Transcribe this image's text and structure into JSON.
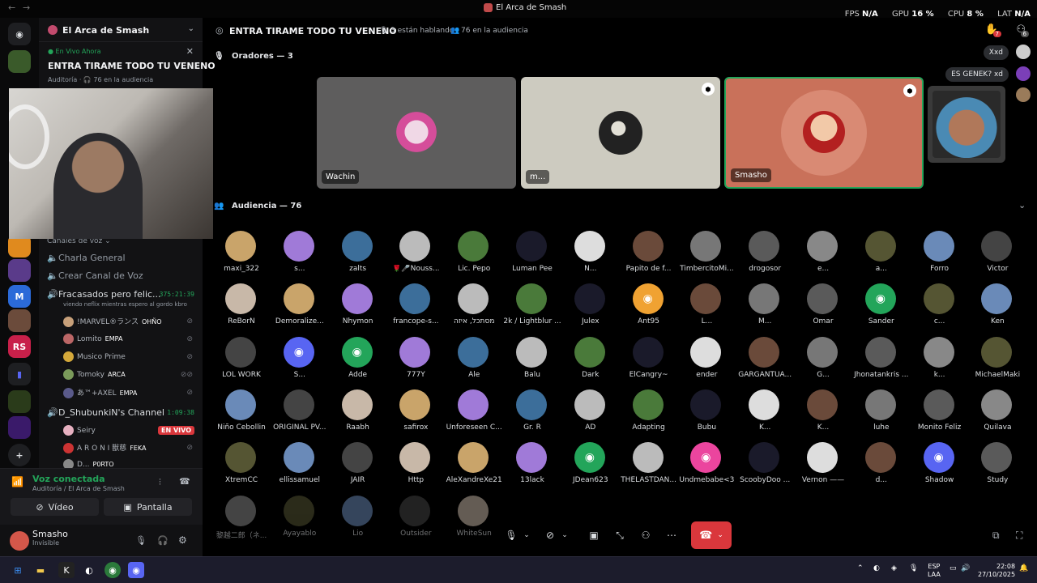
{
  "window": {
    "title": "El Arca de Smash",
    "back": "←",
    "forward": "→"
  },
  "perf": {
    "fps_label": "FPS",
    "fps": "N/A",
    "gpu_label": "GPU",
    "gpu": "16 %",
    "cpu_label": "CPU",
    "cpu": "8 %",
    "lat_label": "LAT",
    "lat": "N/A"
  },
  "guild": {
    "name": "El Arca de Smash"
  },
  "live": {
    "badge": "En Vivo Ahora",
    "stage_title": "ENTRA TIRAME TODO TU VENENO",
    "sub": "Auditoría · 🎧 76 en la audiencia"
  },
  "categories": {
    "voice": "Canales de voz"
  },
  "channels": [
    {
      "name": "Charla General",
      "icon": "speaker-icon"
    },
    {
      "name": "Crear Canal de Voz",
      "icon": "speaker-icon"
    },
    {
      "name": "Fracasados pero felic...",
      "timer": "375:21:39",
      "status": "viendo neflix mientras espero al gordo kbro"
    },
    {
      "name": "D_ShubunkiN's Channel",
      "timer": "1:09:38"
    }
  ],
  "voice_users_a": [
    {
      "name": "!MARVEL®ランス",
      "tag": "OHÑO"
    },
    {
      "name": "Lomito",
      "tag": "EMPA"
    },
    {
      "name": "Musico Prime",
      "tag": ""
    },
    {
      "name": "Tomoky",
      "tag": "ARCA"
    },
    {
      "name": "あ™+AXEL",
      "tag": "EMPA"
    }
  ],
  "voice_users_b": [
    {
      "name": "Seiry",
      "tag": "EN VIVO"
    },
    {
      "name": "A R O N I 獣慈",
      "tag": "FEKA"
    },
    {
      "name": "D...",
      "tag": "P0RTO"
    }
  ],
  "voice_panel": {
    "status": "Voz conectada",
    "location": "Auditoría / El Arca de Smash",
    "video": "Vídeo",
    "screen": "Pantalla"
  },
  "user": {
    "name": "Smasho",
    "status": "Invisible"
  },
  "stage": {
    "title": "ENTRA TIRAME TODO TU VENENO",
    "speaking": "3 están hablando",
    "audience": "76 en la audiencia",
    "speakers_header": "Oradores — 3",
    "audience_header": "Audiencia — 76",
    "notif_count": "7",
    "notif_count2": "6"
  },
  "speakers": [
    {
      "name": "Wachin"
    },
    {
      "name": "m..."
    },
    {
      "name": "Smasho"
    }
  ],
  "chat": [
    {
      "text": "Xxd"
    },
    {
      "text": "ES GENEK? xd"
    }
  ],
  "audience": [
    "maxi_322",
    "s...",
    "zalts",
    "🌹🎤Nouss...",
    "Lic. Pepo",
    "Luman Pee",
    "N...",
    "Papito de f...",
    "TimbercitoMi...",
    "drogosor",
    "e...",
    "a...",
    "Forro",
    "Victor",
    "ReBorN",
    "Demoralize...",
    "Nhymon",
    "francope-s...",
    "מסתכל, איזה",
    "2k / Lightblur ...",
    "Julex",
    "Ant95",
    "L...",
    "M...",
    "Omar",
    "Sander",
    "c...",
    "Ken",
    "LOL WORK",
    "S...",
    "Adde",
    "777Y",
    "Ale",
    "Balu",
    "Dark",
    "ElCangry~",
    "ender",
    "GARGANTUA...",
    "G...",
    "Jhonatankris ...",
    "k...",
    "MichaelMaki",
    "Niño Cebollin",
    "ORIGINAL PV...",
    "Raabh",
    "safirox",
    "Unforeseen C...",
    "Gr. R",
    "AD",
    "Adapting",
    "Bubu",
    "K...",
    "K...",
    "luhe",
    "Monito Feliz",
    "Quilava",
    "XtremCC",
    "ellissamuel",
    "JAIR",
    "Http",
    "AleXandreXe21",
    "13lack",
    "JDean623",
    "THELASTDAN...",
    "Undmebabe<3",
    "ScoobyDoo ...",
    "Vernon ——",
    "d...",
    "Shadow",
    "Study",
    "黎越二郎（ネ...",
    "Ayayablo",
    "Lio",
    "Outsider",
    "WhiteSun",
    ""
  ],
  "taskbar": {
    "lang": "ESP",
    "layout": "LAA",
    "time": "22:08",
    "date": "27/10/2025"
  }
}
